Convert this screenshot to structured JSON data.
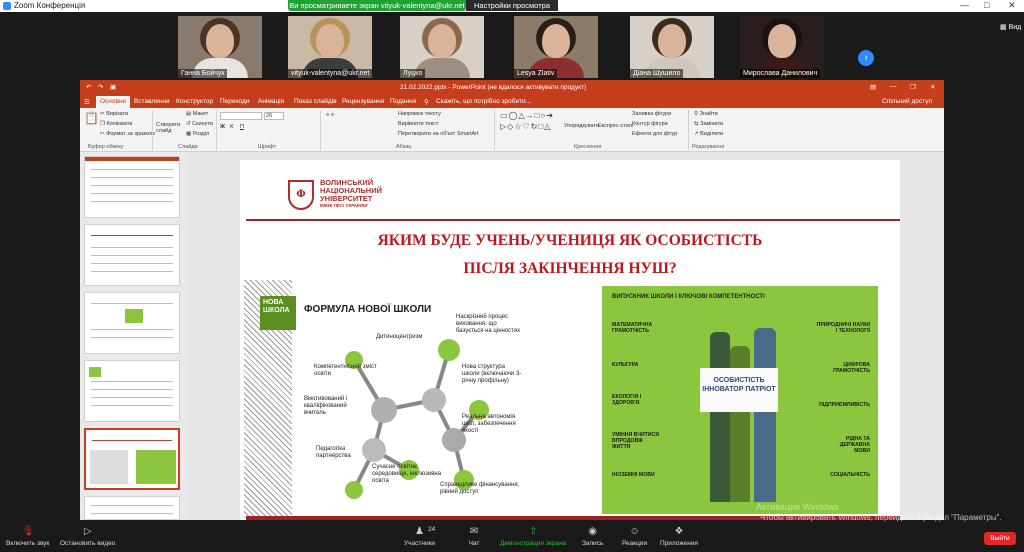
{
  "zoom": {
    "window_title": "Zoom Конференція",
    "share_banner": "Ви просматриваете экран vityuk-valentyna@ukr.net",
    "view_settings": "Настройки просмотра",
    "view_button": "Вид",
    "participants_thumbnails": [
      {
        "name": "Ганна Бойчук"
      },
      {
        "name": "vityuk-valentyna@ukr.net"
      },
      {
        "name": "Луцко"
      },
      {
        "name": "Lesya Zlativ"
      },
      {
        "name": "Діана Шушило"
      },
      {
        "name": "Мирослава Данилович"
      }
    ],
    "toolbar": {
      "mute": "Включить звук",
      "video": "Остановить видео",
      "participants": "Участники",
      "participants_count": "24",
      "chat": "Чат",
      "share": "Демонстрация экрана",
      "record": "Запись",
      "reactions": "Реакции",
      "apps": "Приложения",
      "leave": "Выйти"
    },
    "activate_windows_1": "Активация Windows",
    "activate_windows_2": "Чтобы активировать Windows, перейдите в раздел \"Параметры\"."
  },
  "powerpoint": {
    "title": "21.02.2022.pptx - PowerPoint (не вдалося активувати продукт)",
    "search_hint": "Скажіть, що потрібно зробити...",
    "shared_access": "Спільний доступ",
    "tabs": [
      "Основне",
      "Вставлення",
      "Конструктор",
      "Переходи",
      "Анімація",
      "Показ слайдів",
      "Рецензування",
      "Подання"
    ],
    "ribbon": {
      "cut": "Вирізати",
      "copy": "Копіювати",
      "format_painter": "Формат за зразком",
      "clipboard_group": "Буфер обміну",
      "new_slide": "Створити слайд",
      "layout": "Макет",
      "reset": "Скинути",
      "section": "Розділ",
      "slides_group": "Слайди",
      "font_size": "20",
      "font_group": "Шрифт",
      "text_direction": "Напрямок тексту",
      "align_text": "Вирівняти текст",
      "smartart": "Перетворити на об'єкт SmartArt",
      "paragraph_group": "Абзац",
      "arrange": "Упорядкувати",
      "quick_styles": "Експрес-стилі",
      "shape_fill": "Заливка фігури",
      "shape_outline": "Контур фігури",
      "shape_effects": "Ефекти для фігур",
      "drawing_group": "Креслення",
      "find": "Знайти",
      "replace": "Замінити",
      "select": "Виділити",
      "editing_group": "Редагування"
    }
  },
  "slide": {
    "univ_name": "ВОЛИНСЬКИЙ НАЦІОНАЛЬНИЙ УНІВЕРСИТЕТ",
    "univ_sub": "ІМЕНІ ЛЕСІ УКРАЇНКИ",
    "title_line1": "ЯКИМ БУДЕ УЧЕНЬ/УЧЕНИЦЯ ЯК ОСОБИСТІСТЬ",
    "title_line2": "ПІСЛЯ ЗАКІНЧЕННЯ НУШ?",
    "nush_logo": "НОВА ШКОЛА",
    "formula_title": "ФОРМУЛА НОВОЇ ШКОЛИ",
    "formula_items": {
      "child_centrism": "Дитиноцентризм",
      "values": "Наскрізний процес виховання, що базується на цінностях",
      "competent_content": "Компетентнісний зміст освіти",
      "teacher": "Вмотивований і кваліфікований вчитель",
      "structure": "Нова структура школи (включаючи 3-річну профільну)",
      "autonomy": "Реальна автономія шкіл, забезпечення якості",
      "partnership": "Педагогіка партнерства",
      "environment": "Сучасне освітнє середовище, інклюзивна освіта",
      "funding": "Справедливе фінансування, рівний доступ"
    },
    "competencies_title": "ВИПУСКНИК ШКОЛИ І КЛЮЧОВІ КОМПЕТЕНТНОСТІ",
    "poster": "ОСОБИСТІСТЬ ІННОВАТОР ПАТРІОТ",
    "competencies": {
      "math": "МАТЕМАТИЧНА ГРАМОТНІСТЬ",
      "culture": "КУЛЬТУРА",
      "ecology": "ЕКОЛОГІЯ І ЗДОРОВ'Я",
      "lifelong": "УМІННЯ ВЧИТИСЯ ВПРОДОВЖ ЖИТТЯ",
      "languages": "ІНОЗЕМНІ МОВИ",
      "science": "ПРИРОДНИЧІ НАУКИ І ТЕХНОЛОГІЇ",
      "digital": "ЦИФРОВА ГРАМОТНІСТЬ",
      "entrepreneurship": "ПІДПРИЄМЛИВІСТЬ",
      "native": "РІДНА ТА ДЕРЖАВНА МОВИ",
      "social": "СОЦІАЛЬНІСТЬ"
    }
  }
}
